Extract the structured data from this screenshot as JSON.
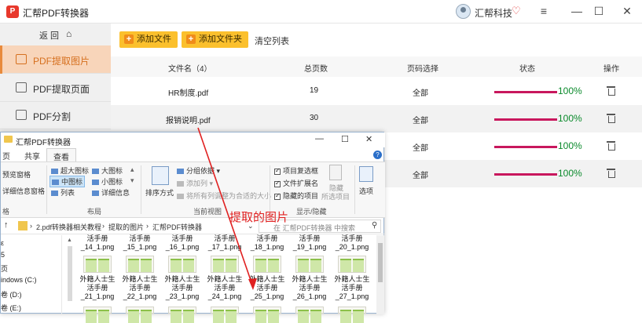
{
  "app": {
    "logo": "P",
    "title": "汇帮PDF转换器",
    "user_name": "汇帮科技",
    "window_controls": [
      "≡",
      "—",
      "☐",
      "✕"
    ]
  },
  "sidebar": {
    "back_label": "返 回",
    "home_icon": "⌂",
    "items": [
      {
        "label": "PDF提取图片",
        "active": true
      },
      {
        "label": "PDF提取页面",
        "active": false
      },
      {
        "label": "PDF分割",
        "active": false
      }
    ]
  },
  "toolbar": {
    "add_file": "添加文件",
    "add_folder": "添加文件夹",
    "clear_list": "清空列表"
  },
  "table": {
    "headers": [
      "文件名（4）",
      "总页数",
      "页码选择",
      "状态",
      "操作"
    ],
    "rows": [
      {
        "name": "HR制度.pdf",
        "pages": "19",
        "range": "全部",
        "progress": "100%"
      },
      {
        "name": "报销说明.pdf",
        "pages": "30",
        "range": "全部",
        "progress": "100%"
      },
      {
        "name": "",
        "pages": "",
        "range": "全部",
        "progress": "100%"
      },
      {
        "name": "",
        "pages": "",
        "range": "全部",
        "progress": "100%"
      }
    ]
  },
  "explorer": {
    "title": "汇帮PDF转换器",
    "window_controls": [
      "—",
      "☐",
      "✕"
    ],
    "tabs": [
      "页",
      "共享",
      "查看"
    ],
    "ribbon": {
      "panes": [
        "预览窗格",
        "详细信息窗格"
      ],
      "panes_group": "格",
      "layout_items": [
        "超大图标",
        "大图标",
        "中图标",
        "小图标",
        "列表",
        "详细信息"
      ],
      "layout_group": "布局",
      "sort_label": "排序方式",
      "group_by": "分组依据",
      "add_column": "添加列",
      "fit_columns": "将所有列调整为合适的大小",
      "current_view_group": "当前视图",
      "show_items": [
        "项目复选框",
        "文件扩展名",
        "隐藏的项目"
      ],
      "hide_selected_1": "隐藏",
      "hide_selected_2": "所选项目",
      "show_hide_group": "显示/隐藏",
      "options": "选项"
    },
    "address": {
      "path": [
        "2.pdf转换器相关教程",
        "提取的图片",
        "汇帮PDF转换器"
      ],
      "search_placeholder": "在 汇帮PDF转换器 中搜索"
    },
    "nav_items": [
      "ε",
      "5",
      "页",
      "indows (C:)",
      "卷 (D:)",
      "卷 (E:)"
    ],
    "files_top": [
      {
        "l1": "活手册",
        "l2": "_14_1.png"
      },
      {
        "l1": "活手册",
        "l2": "_15_1.png"
      },
      {
        "l1": "活手册",
        "l2": "_16_1.png"
      },
      {
        "l1": "活手册",
        "l2": "_17_1.png"
      },
      {
        "l1": "活手册",
        "l2": "_18_1.png"
      },
      {
        "l1": "活手册",
        "l2": "_19_1.png"
      },
      {
        "l1": "活手册",
        "l2": "_20_1.png"
      }
    ],
    "files": [
      {
        "l0": "外籍人士生",
        "l1": "活手册",
        "l2": "_21_1.png"
      },
      {
        "l0": "外籍人士生",
        "l1": "活手册",
        "l2": "_22_1.png"
      },
      {
        "l0": "外籍人士生",
        "l1": "活手册",
        "l2": "_23_1.png"
      },
      {
        "l0": "外籍人士生",
        "l1": "活手册",
        "l2": "_24_1.png"
      },
      {
        "l0": "外籍人士生",
        "l1": "活手册",
        "l2": "_25_1.png"
      },
      {
        "l0": "外籍人士生",
        "l1": "活手册",
        "l2": "_26_1.png"
      },
      {
        "l0": "外籍人士生",
        "l1": "活手册",
        "l2": "_27_1.png"
      }
    ]
  },
  "annotation": "提取的图片",
  "colors": {
    "accent_orange": "#e88a3c",
    "active_bg": "#f8d5ba",
    "button_yellow": "#fbc02d",
    "progress_bar": "#c8175d",
    "progress_text": "#0b8a2c",
    "annotation_red": "#e02020"
  }
}
